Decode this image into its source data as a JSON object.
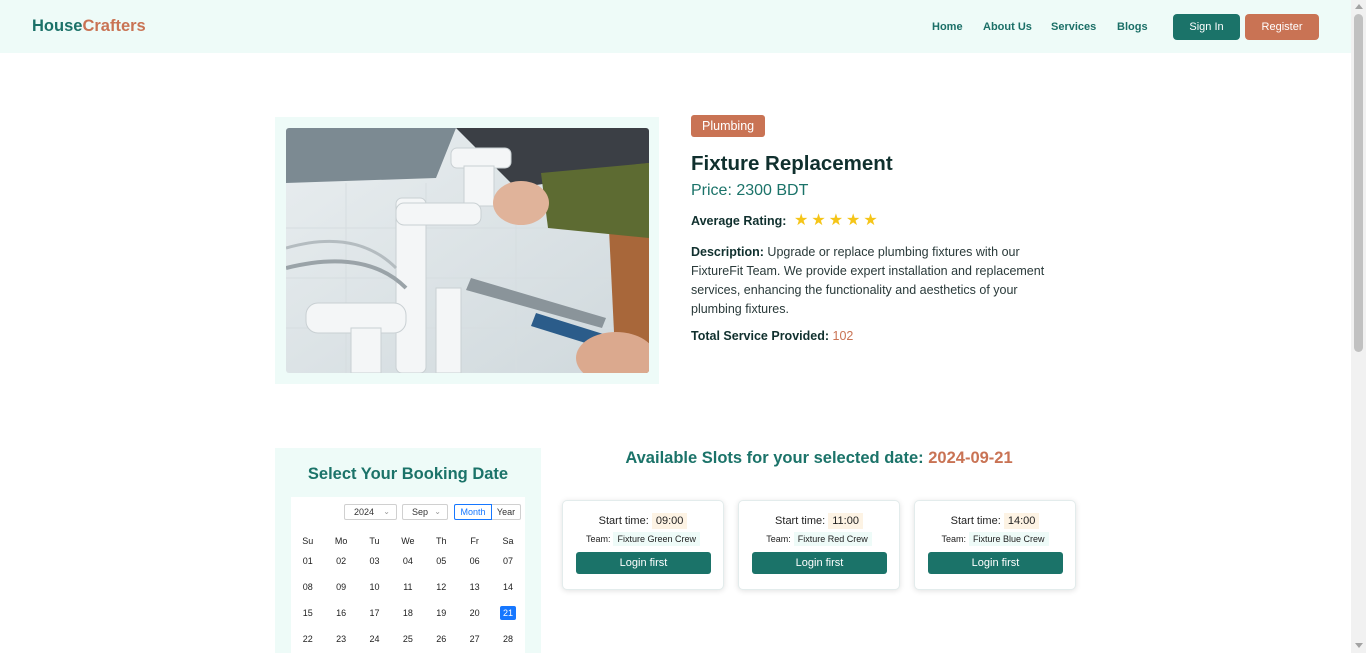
{
  "header": {
    "logo_part1": "House",
    "logo_part2": "Crafters",
    "nav": [
      "Home",
      "About Us",
      "Services",
      "Blogs"
    ],
    "signin_label": "Sign In",
    "register_label": "Register"
  },
  "service": {
    "category": "Plumbing",
    "title": "Fixture Replacement",
    "price": "Price: 2300 BDT",
    "rating_label": "Average Rating:",
    "rating": 5,
    "rating_max": 5,
    "description_label": "Description:",
    "description": "Upgrade or replace plumbing fixtures with our FixtureFit Team. We provide expert installation and replacement services, enhancing the functionality and aesthetics of your plumbing fixtures.",
    "total_label": "Total Service Provided:",
    "total_value": "102",
    "image_icon": "plumber-fixing-sink-pipe-photo"
  },
  "calendar": {
    "title": "Select Your Booking Date",
    "year": "2024",
    "month": "Sep",
    "mode_month": "Month",
    "mode_year": "Year",
    "weekdays": [
      "Su",
      "Mo",
      "Tu",
      "We",
      "Th",
      "Fr",
      "Sa"
    ],
    "weeks": [
      [
        "01",
        "02",
        "03",
        "04",
        "05",
        "06",
        "07"
      ],
      [
        "08",
        "09",
        "10",
        "11",
        "12",
        "13",
        "14"
      ],
      [
        "15",
        "16",
        "17",
        "18",
        "19",
        "20",
        "21"
      ],
      [
        "22",
        "23",
        "24",
        "25",
        "26",
        "27",
        "28"
      ]
    ],
    "selected": "21"
  },
  "slots": {
    "heading": "Available Slots for your selected date:",
    "date": "2024-09-21",
    "start_label": "Start time:",
    "team_label": "Team:",
    "button_label": "Login first",
    "items": [
      {
        "start": "09:00",
        "team": "Fixture Green Crew"
      },
      {
        "start": "11:00",
        "team": "Fixture Red Crew"
      },
      {
        "start": "14:00",
        "team": "Fixture Blue Crew"
      }
    ]
  },
  "colors": {
    "primary": "#1b7369",
    "accent": "#c97354",
    "panel": "#eefbf8",
    "star": "#f5c518",
    "calendar_selected": "#1677ff"
  }
}
